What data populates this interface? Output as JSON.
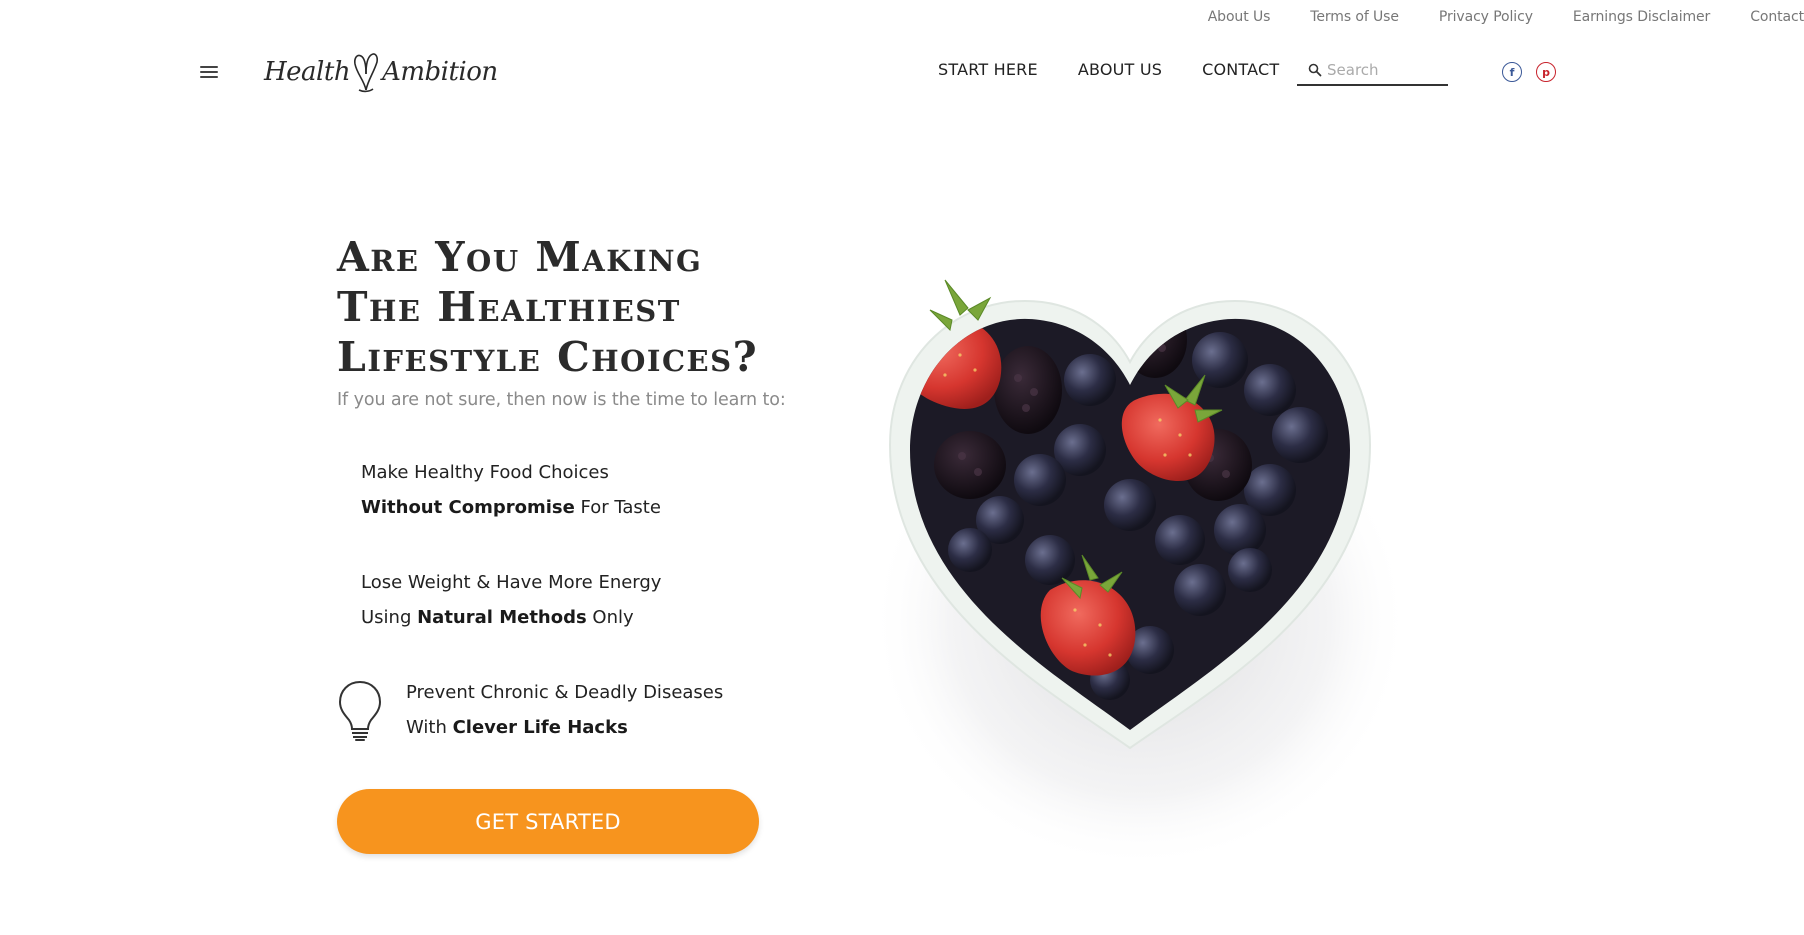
{
  "utility_nav": {
    "links": [
      "About Us",
      "Terms of Use",
      "Privacy Policy",
      "Earnings Disclaimer",
      "Contact"
    ]
  },
  "brand": {
    "logo_part1": "Health",
    "logo_part2": "Ambition"
  },
  "main_nav": {
    "links": [
      "START HERE",
      "ABOUT US",
      "CONTACT"
    ]
  },
  "search": {
    "placeholder": "Search",
    "value": ""
  },
  "social": {
    "facebook_glyph": "f",
    "pinterest_glyph": "p"
  },
  "hero": {
    "title_line1": "Are You Making",
    "title_line2": "The Healthiest",
    "title_line3": "Lifestyle Choices?",
    "subtitle": "If you are not sure, then now is the time to learn to:",
    "benefits": [
      {
        "line1": "Make Healthy Food Choices",
        "line2_bold": "Without Compromise",
        "line2_rest": " For Taste",
        "icon": "food-icon"
      },
      {
        "line1": "Lose Weight & Have More Energy",
        "line2_pre": "Using ",
        "line2_bold": "Natural Methods",
        "line2_rest": " Only",
        "icon": "energy-icon"
      },
      {
        "line1": "Prevent Chronic & Deadly Diseases",
        "line2_pre": "With ",
        "line2_bold": "Clever Life Hacks",
        "icon": "lightbulb-icon"
      }
    ],
    "cta_label": "GET STARTED"
  },
  "colors": {
    "accent": "#f7941e",
    "facebook": "#3b5998",
    "pinterest": "#c8232c",
    "text_dark": "#222222",
    "text_muted": "#8a8a8a"
  },
  "image": {
    "icon": "heart-bowl-berries-image"
  }
}
